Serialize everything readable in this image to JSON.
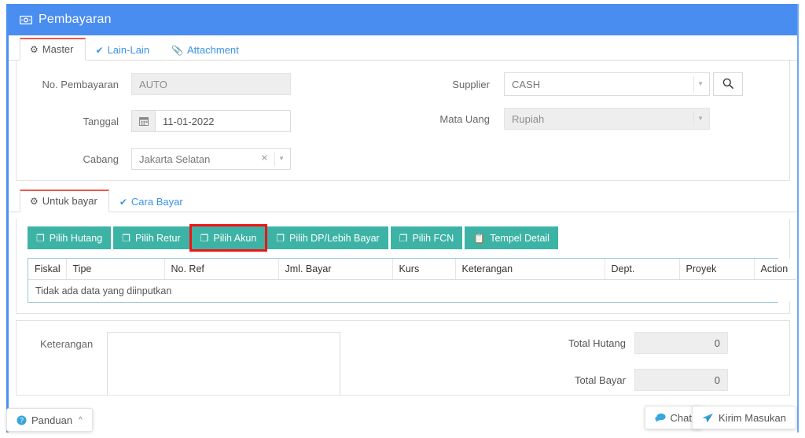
{
  "window": {
    "title": "Pembayaran",
    "title_icon": "money-bill-icon",
    "accent_blue": "#4a8df0",
    "accent_teal": "#3db3a6",
    "highlight_red": "#f01414"
  },
  "master_tabs": [
    {
      "label": "Master",
      "icon": "cogs-icon",
      "active": true
    },
    {
      "label": "Lain-Lain",
      "icon": "check-circle-icon",
      "active": false
    },
    {
      "label": "Attachment",
      "icon": "paperclip-icon",
      "active": false
    }
  ],
  "master_form": {
    "no_pembayaran": {
      "label": "No. Pembayaran",
      "value": "AUTO",
      "readonly": true
    },
    "tanggal": {
      "label": "Tanggal",
      "value": "11-01-2022",
      "icon": "calendar-icon"
    },
    "cabang": {
      "label": "Cabang",
      "value": "Jakarta Selatan",
      "clear_icon": "times-icon",
      "caret_icon": "caret-down-icon"
    },
    "supplier": {
      "label": "Supplier",
      "value": "CASH",
      "caret_icon": "caret-down-icon",
      "search_icon": "search-icon"
    },
    "mata_uang": {
      "label": "Mata Uang",
      "value": "Rupiah",
      "caret_icon": "caret-down-icon"
    }
  },
  "detail_tabs": [
    {
      "label": "Untuk bayar",
      "icon": "cogs-icon",
      "active": true
    },
    {
      "label": "Cara Bayar",
      "icon": "check-circle-icon",
      "active": false
    }
  ],
  "toolbar_buttons": [
    {
      "label": "Pilih Hutang",
      "icon": "copy-icon",
      "highlighted": false
    },
    {
      "label": "Pilih Retur",
      "icon": "copy-icon",
      "highlighted": false
    },
    {
      "label": "Pilih Akun",
      "icon": "copy-icon",
      "highlighted": true
    },
    {
      "label": "Pilih DP/Lebih Bayar",
      "icon": "copy-icon",
      "highlighted": false
    },
    {
      "label": "Pilih FCN",
      "icon": "copy-icon",
      "highlighted": false
    },
    {
      "label": "Tempel Detail",
      "icon": "paste-icon",
      "highlighted": false
    }
  ],
  "grid": {
    "columns": [
      "Fiskal",
      "Tipe",
      "No. Ref",
      "Jml. Bayar",
      "Kurs",
      "Keterangan",
      "Dept.",
      "Proyek",
      "Action"
    ],
    "rows": [],
    "empty_message": "Tidak ada data yang diinputkan"
  },
  "footer": {
    "keterangan_label": "Keterangan",
    "keterangan_value": "",
    "totals": [
      {
        "label": "Total Hutang",
        "value": "0"
      },
      {
        "label": "Total Bayar",
        "value": "0"
      }
    ]
  },
  "floating": {
    "panduan": {
      "label": "Panduan",
      "icon": "question-circle-icon",
      "chevron": "chevron-up-icon"
    },
    "chat": {
      "label": "Chat",
      "icon": "comment-icon"
    },
    "kirim": {
      "label": "Kirim Masukan",
      "icon": "paper-plane-icon"
    }
  }
}
